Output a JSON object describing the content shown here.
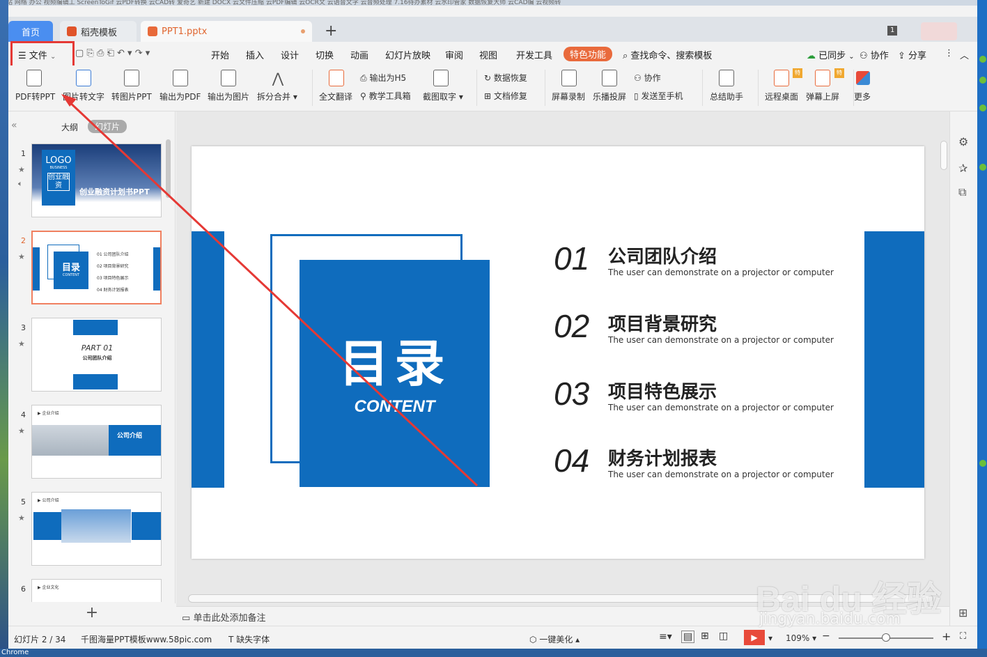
{
  "desktop": {
    "top_text": "收站   网络   办公   视频编辑工   ScreenToGif   云PDF转换   云CAD转   爱奇艺   新建 DOCX   云文件压缩   云PDF编辑   云OCR文   云语音文字   云音频处理   7.16待办素材   云水印管家   数据恢复大师   云CAD编   云视频转",
    "bottom_text": "Chrome"
  },
  "titlebar": {
    "tabs": [
      {
        "label": "首页"
      },
      {
        "label": "稻壳模板"
      },
      {
        "label": "PPT1.pptx"
      }
    ],
    "page_count": "1"
  },
  "menu": {
    "file": "文件",
    "items": [
      "开始",
      "插入",
      "设计",
      "切换",
      "动画",
      "幻灯片放映",
      "审阅",
      "视图",
      "开发工具"
    ],
    "special": "特色功能",
    "search": "查找命令、搜索模板",
    "sync": "已同步",
    "collab": "协作",
    "share": "分享"
  },
  "toolbar": {
    "big": [
      "PDF转PPT",
      "图片转文字",
      "转图片PPT",
      "输出为PDF",
      "输出为图片",
      "拆分合并"
    ],
    "translate": "全文翻译",
    "h5": "输出为H5",
    "teach": "教学工具箱",
    "ocr": "截图取字",
    "data_recover": "数据恢复",
    "doc_repair": "文档修复",
    "record": "屏幕录制",
    "lebo": "乐播投屏",
    "collab": "协作",
    "send_phone": "发送至手机",
    "summary": "总结助手",
    "remote": "远程桌面",
    "danmu": "弹幕上屏",
    "more": "更多",
    "badge": "特"
  },
  "leftpanel": {
    "tab_outline": "大纲",
    "tab_slides": "幻灯片",
    "thumbs": [
      {
        "num": "1",
        "title": "创业融资计划书PPT",
        "logo": "LOGO",
        "logo_sub": "BUSINESS",
        "box": "创业融资"
      },
      {
        "num": "2",
        "title": "目录",
        "sub": "CONTENT",
        "items": [
          "01  公司团队介绍",
          "02  项目背景研究",
          "03  项目特色展示",
          "04  财务计划报表"
        ]
      },
      {
        "num": "3",
        "title": "PART 01",
        "sub": "公司团队介绍"
      },
      {
        "num": "4",
        "head": "企业介绍",
        "title": "公司介绍"
      },
      {
        "num": "5",
        "head": "公司介绍"
      },
      {
        "num": "6",
        "head": "企业文化"
      }
    ]
  },
  "slide": {
    "title": "目录",
    "subtitle": "CONTENT",
    "items": [
      {
        "num": "01",
        "title": "公司团队介绍",
        "sub": "The user can demonstrate on a projector or computer"
      },
      {
        "num": "02",
        "title": "项目背景研究",
        "sub": "The user can demonstrate on a projector or computer"
      },
      {
        "num": "03",
        "title": "项目特色展示",
        "sub": "The user can demonstrate on a projector or computer"
      },
      {
        "num": "04",
        "title": "财务计划报表",
        "sub": "The user can demonstrate on a projector or computer"
      }
    ]
  },
  "notes": {
    "placeholder": "单击此处添加备注"
  },
  "statusbar": {
    "slide_pos": "幻灯片 2 / 34",
    "template": "千图海量PPT模板www.58pic.com",
    "missing_font": "缺失字体",
    "beautify": "一键美化",
    "zoom": "109%"
  },
  "watermark": {
    "main": "Bai du 经验",
    "sub": "jingyan.baidu.com"
  },
  "colors": {
    "accent": "#0f6cbd",
    "highlight": "#e53935",
    "wps_orange": "#e96a3c"
  }
}
